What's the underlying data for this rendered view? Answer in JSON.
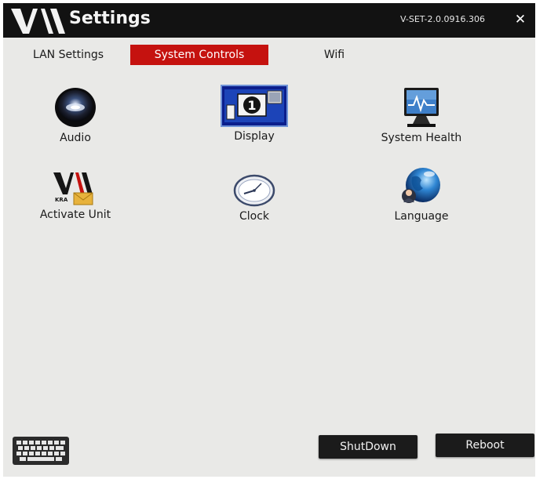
{
  "window": {
    "title": "Settings",
    "version": "V-SET-2.0.0916.306",
    "close_icon": "close-icon"
  },
  "tabs": [
    {
      "label": "LAN Settings",
      "active": false
    },
    {
      "label": "System Controls",
      "active": true
    },
    {
      "label": "Wifi",
      "active": false
    }
  ],
  "tiles": [
    {
      "label": "Audio",
      "icon": "audio-icon"
    },
    {
      "label": "Display",
      "icon": "display-icon",
      "selected": true
    },
    {
      "label": "System Health",
      "icon": "system-health-icon"
    },
    {
      "label": "Activate Unit",
      "icon": "activate-unit-icon"
    },
    {
      "label": "Clock",
      "icon": "clock-icon"
    },
    {
      "label": "Language",
      "icon": "language-icon"
    }
  ],
  "footer": {
    "keyboard_icon": "keyboard-icon",
    "shutdown_label": "ShutDown",
    "reboot_label": "Reboot"
  },
  "colors": {
    "titlebar": "#121212",
    "active_tab": "#c5120f",
    "background": "#e9e9e7",
    "button": "#1b1b1b"
  }
}
